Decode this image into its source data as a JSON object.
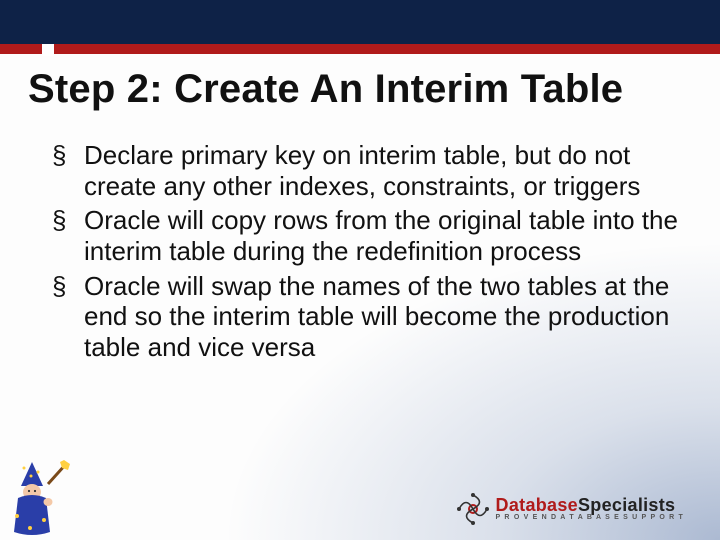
{
  "title": "Step 2: Create An Interim Table",
  "bullets": [
    "Declare primary key on interim table, but do not create any other indexes, constraints, or triggers",
    "Oracle will copy rows from the original table into the interim table during the redefinition process",
    "Oracle will swap the names of the two tables at the end so the interim table will become the production table and vice versa"
  ],
  "logo": {
    "word1": "Database",
    "word2": "Specialists",
    "subtitle": "P R O V E N  D A T A B A S E  S U P P O R T"
  }
}
